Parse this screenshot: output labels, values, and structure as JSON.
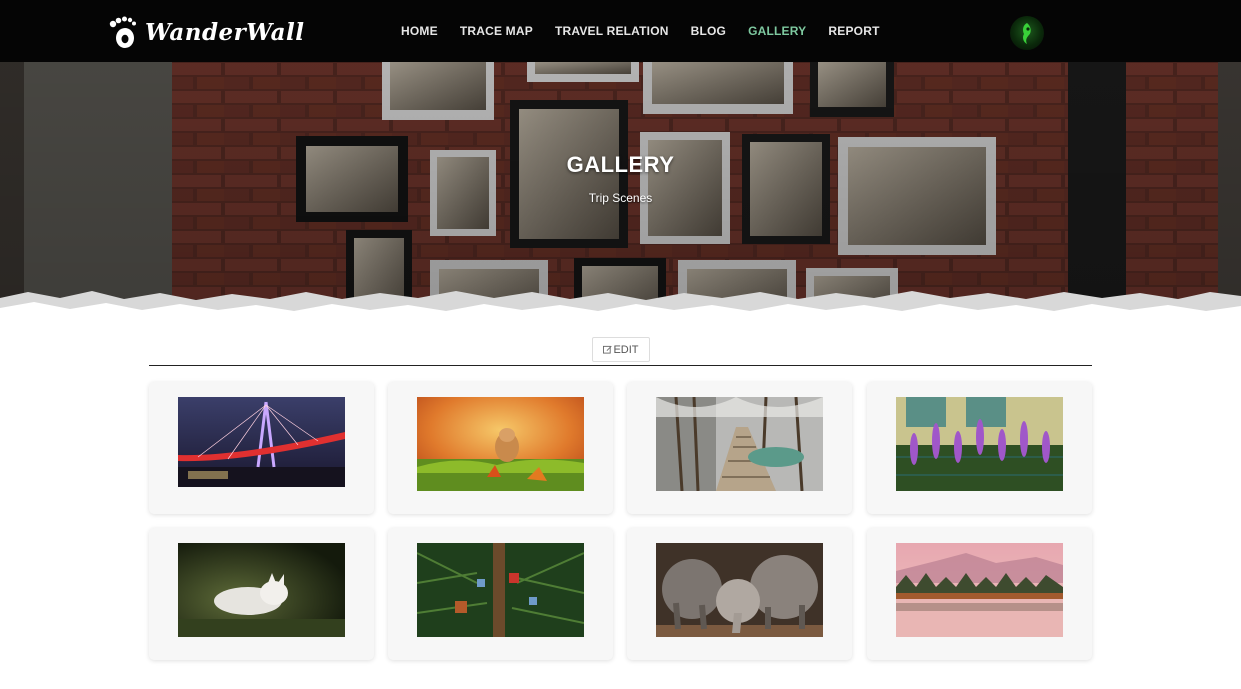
{
  "brand": {
    "name": "WanderWall",
    "logo_icon": "footprint-icon"
  },
  "nav": {
    "items": [
      {
        "label": "HOME",
        "active": false
      },
      {
        "label": "TRACE MAP",
        "active": false
      },
      {
        "label": "TRAVEL RELATION",
        "active": false
      },
      {
        "label": "BLOG",
        "active": false
      },
      {
        "label": "GALLERY",
        "active": true
      },
      {
        "label": "REPORT",
        "active": false
      }
    ],
    "active_color": "#7ec9a0",
    "avatar_icon": "user-avatar"
  },
  "hero": {
    "title": "GALLERY",
    "subtitle": "Trip Scenes"
  },
  "toolbar": {
    "edit_label": "EDIT",
    "edit_icon": "edit-icon"
  },
  "gallery": {
    "photos": [
      {
        "subject": "bridge-at-night"
      },
      {
        "subject": "chipmunk-autumn"
      },
      {
        "subject": "wooden-boardwalk-forest"
      },
      {
        "subject": "purple-flowers-fence"
      },
      {
        "subject": "arctic-fox"
      },
      {
        "subject": "pine-tree-birdhouses"
      },
      {
        "subject": "elephants"
      },
      {
        "subject": "misty-lake-mountains"
      }
    ]
  }
}
